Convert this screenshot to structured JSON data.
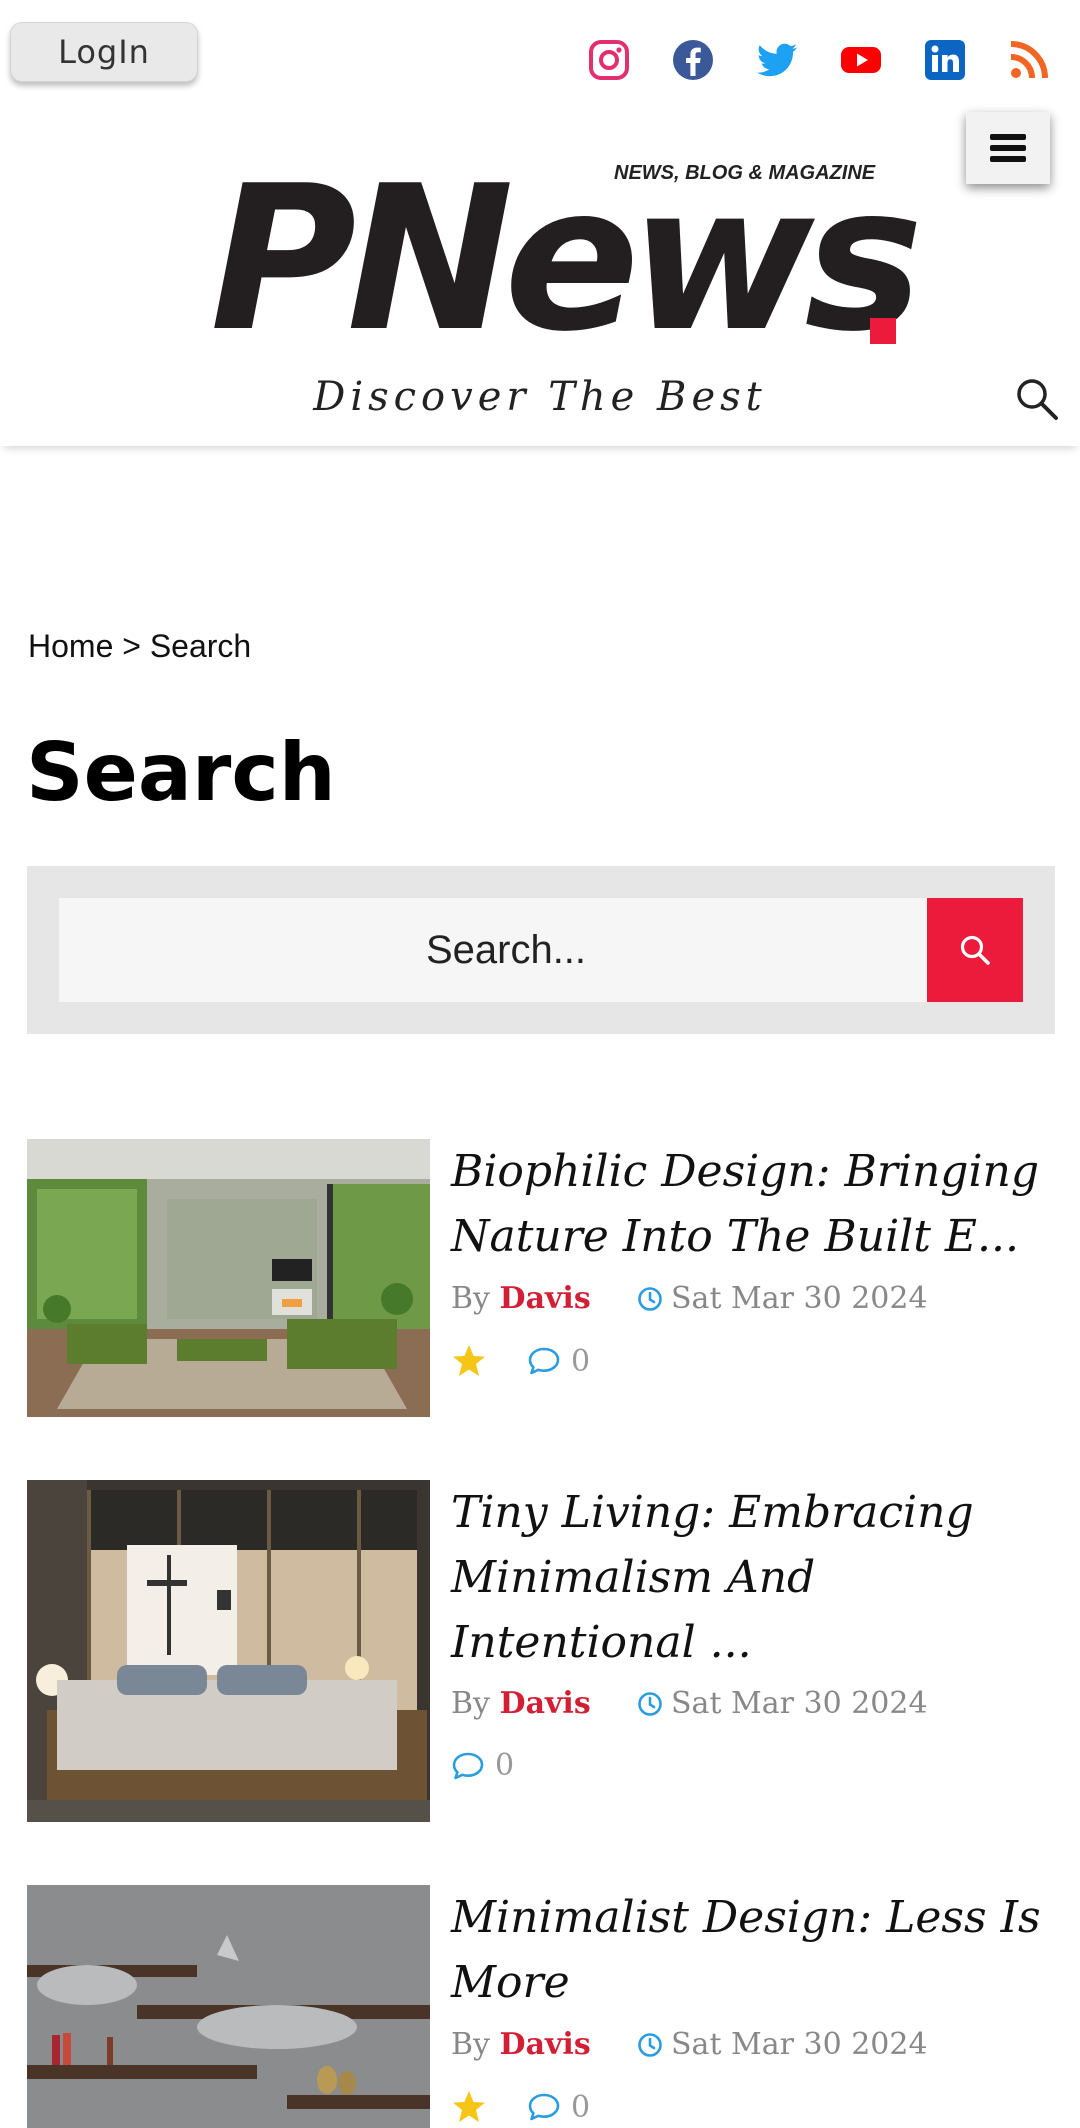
{
  "topbar": {
    "login_label": "LogIn",
    "socials": [
      {
        "icon": "instagram-icon",
        "color": "#e1306c"
      },
      {
        "icon": "facebook-icon",
        "color": "#3b5998"
      },
      {
        "icon": "twitter-icon",
        "color": "#1da1f2"
      },
      {
        "icon": "youtube-icon",
        "color": "#ff0000"
      },
      {
        "icon": "linkedin-icon",
        "color": "#0a66c2"
      },
      {
        "icon": "rss-icon",
        "color": "#f26522"
      }
    ]
  },
  "header": {
    "logo_text": "PNews",
    "tagline": "NEWS, BLOG & MAGAZINE",
    "slogan": "Discover The Best",
    "accent_color": "#ec1b3b"
  },
  "breadcrumb": {
    "home": "Home",
    "separator": ">",
    "current": "Search"
  },
  "page": {
    "title": "Search"
  },
  "search": {
    "placeholder": "Search...",
    "value": ""
  },
  "articles": [
    {
      "title": "Biophilic Design: Bringing Nature Into The Built E...",
      "by": "By",
      "author": "Davis",
      "date": "Sat Mar 30 2024",
      "has_star": true,
      "comments": "0"
    },
    {
      "title": "Tiny Living: Embracing Minimalism And Intentional ...",
      "by": "By",
      "author": "Davis",
      "date": "Sat Mar 30 2024",
      "has_star": false,
      "comments": "0"
    },
    {
      "title": "Minimalist Design: Less Is More",
      "by": "By",
      "author": "Davis",
      "date": "Sat Mar 30 2024",
      "has_star": true,
      "comments": "0"
    }
  ]
}
